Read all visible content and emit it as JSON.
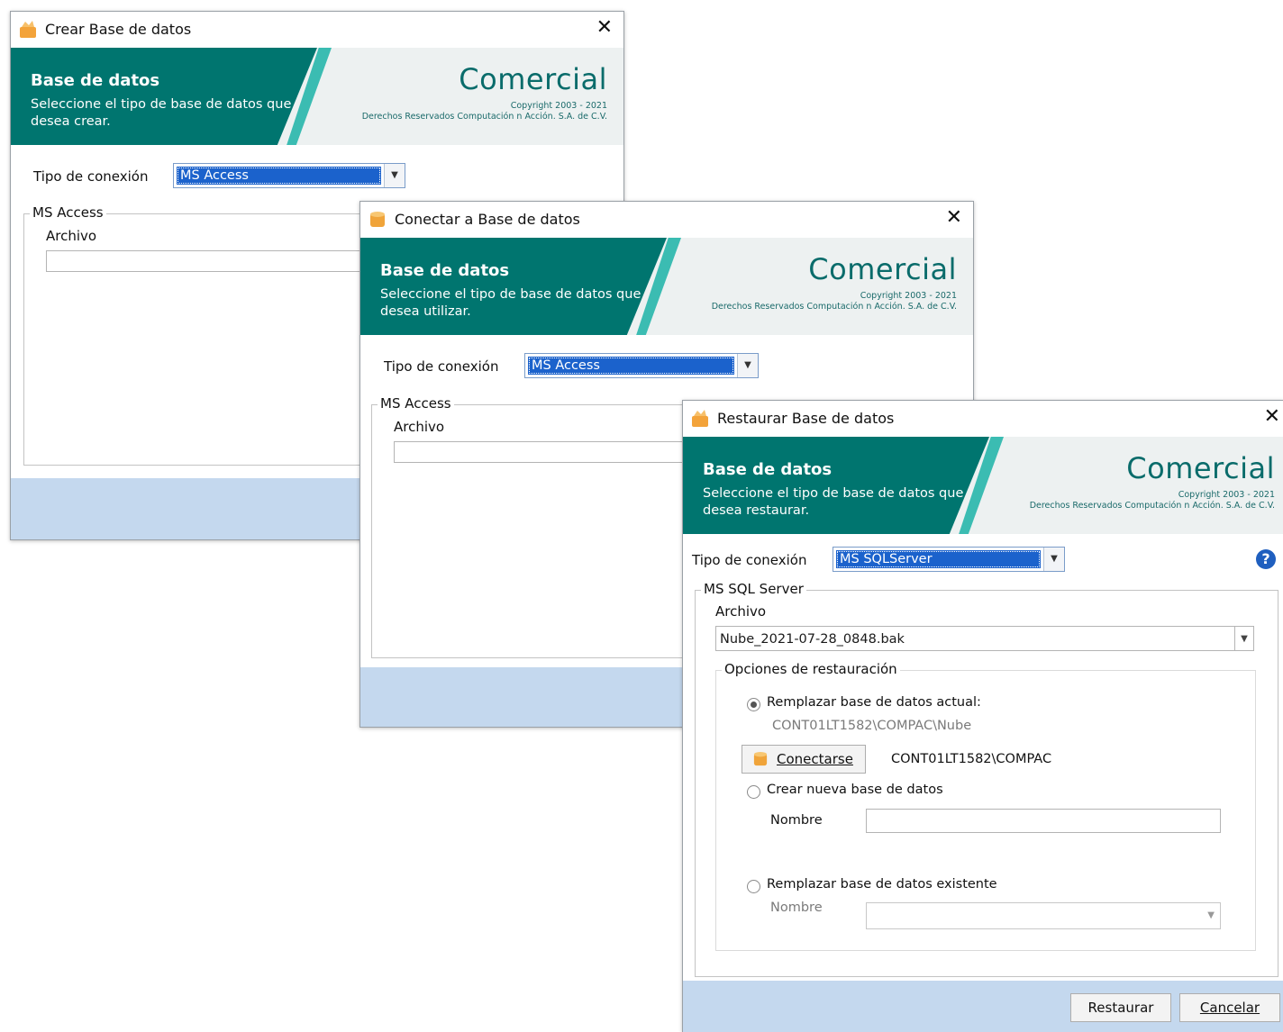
{
  "dialog1": {
    "title": "Crear Base de datos",
    "banner_title": "Base de datos",
    "banner_subtitle": "Seleccione el tipo de base de datos que desea crear.",
    "brand": "Comercial",
    "copyright": "Copyright 2003 - 2021",
    "rights": "Derechos Reservados Computación n Acción. S.A. de C.V.",
    "conn_label": "Tipo de conexión",
    "conn_value": "MS Access",
    "group_label": "MS Access",
    "file_label": "Archivo"
  },
  "dialog2": {
    "title": "Conectar a Base de datos",
    "banner_title": "Base de datos",
    "banner_subtitle": "Seleccione el tipo de base de datos que desea utilizar.",
    "brand": "Comercial",
    "copyright": "Copyright 2003 - 2021",
    "rights": "Derechos Reservados Computación n Acción. S.A. de C.V.",
    "conn_label": "Tipo de conexión",
    "conn_value": "MS Access",
    "group_label": "MS Access",
    "file_label": "Archivo"
  },
  "dialog3": {
    "title": "Restaurar Base de datos",
    "banner_title": "Base de datos",
    "banner_subtitle": "Seleccione el tipo de base de datos que desea restaurar.",
    "brand": "Comercial",
    "copyright": "Copyright 2003 - 2021",
    "rights": "Derechos Reservados Computación n Acción. S.A. de C.V.",
    "conn_label": "Tipo de conexión",
    "conn_value": "MS SQLServer",
    "group_label": "MS SQL Server",
    "file_label": "Archivo",
    "file_value": "Nube_2021-07-28_0848.bak",
    "options_label": "Opciones de restauración",
    "opt_replace_current": "Remplazar base de datos actual:",
    "current_db": "CONT01LT1582\\COMPAC\\Nube",
    "connect_button": "Conectarse",
    "server_name": "CONT01LT1582\\COMPAC",
    "opt_create_new": "Crear nueva base de datos",
    "name_label": "Nombre",
    "opt_replace_existing": "Remplazar base de datos existente",
    "name_label2": "Nombre",
    "restore_button": "Restaurar",
    "cancel_button": "Cancelar",
    "help": "?"
  },
  "colors": {
    "teal": "#00756f",
    "accent_teal": "#3bbcb2",
    "brand_text": "#0a6c6b",
    "footer": "#c4d8ee",
    "selection": "#1b62cc"
  }
}
